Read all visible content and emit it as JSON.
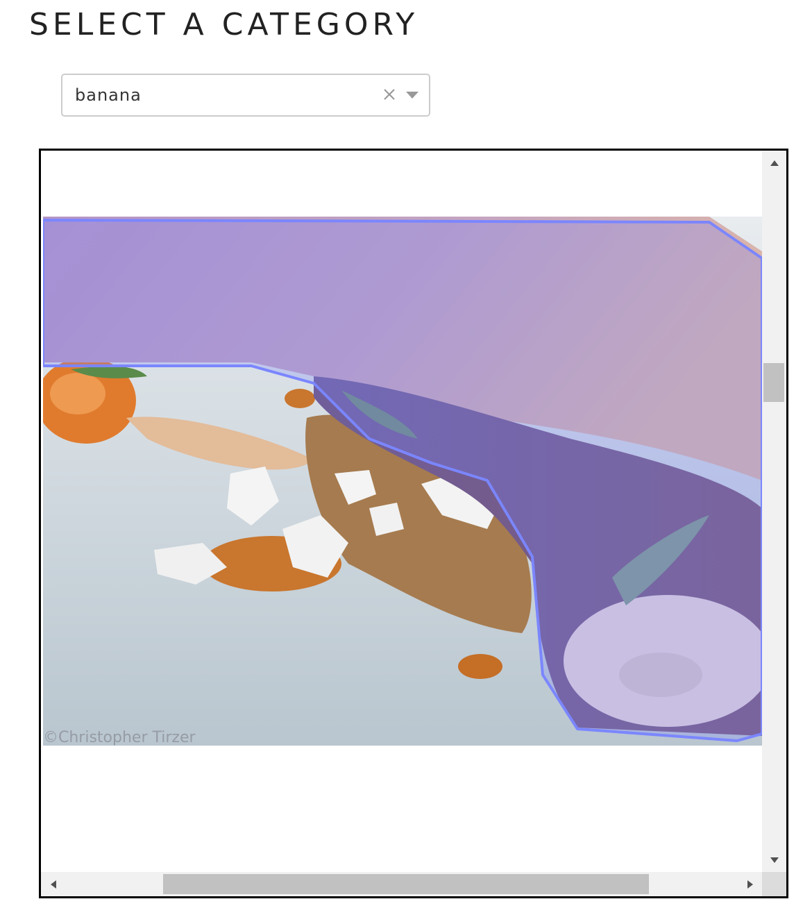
{
  "header": {
    "title": "SELECT A CATEGORY"
  },
  "category_select": {
    "value": "banana",
    "clear_icon": "close-icon",
    "dropdown_icon": "chevron-down-icon"
  },
  "viewer": {
    "image_watermark": "©Christopher Tirzer",
    "overlay_category": "banana",
    "overlay_color": "#7b86ff",
    "vertical_scroll_position": 0.3,
    "horizontal_scroll_position": 0.2
  }
}
